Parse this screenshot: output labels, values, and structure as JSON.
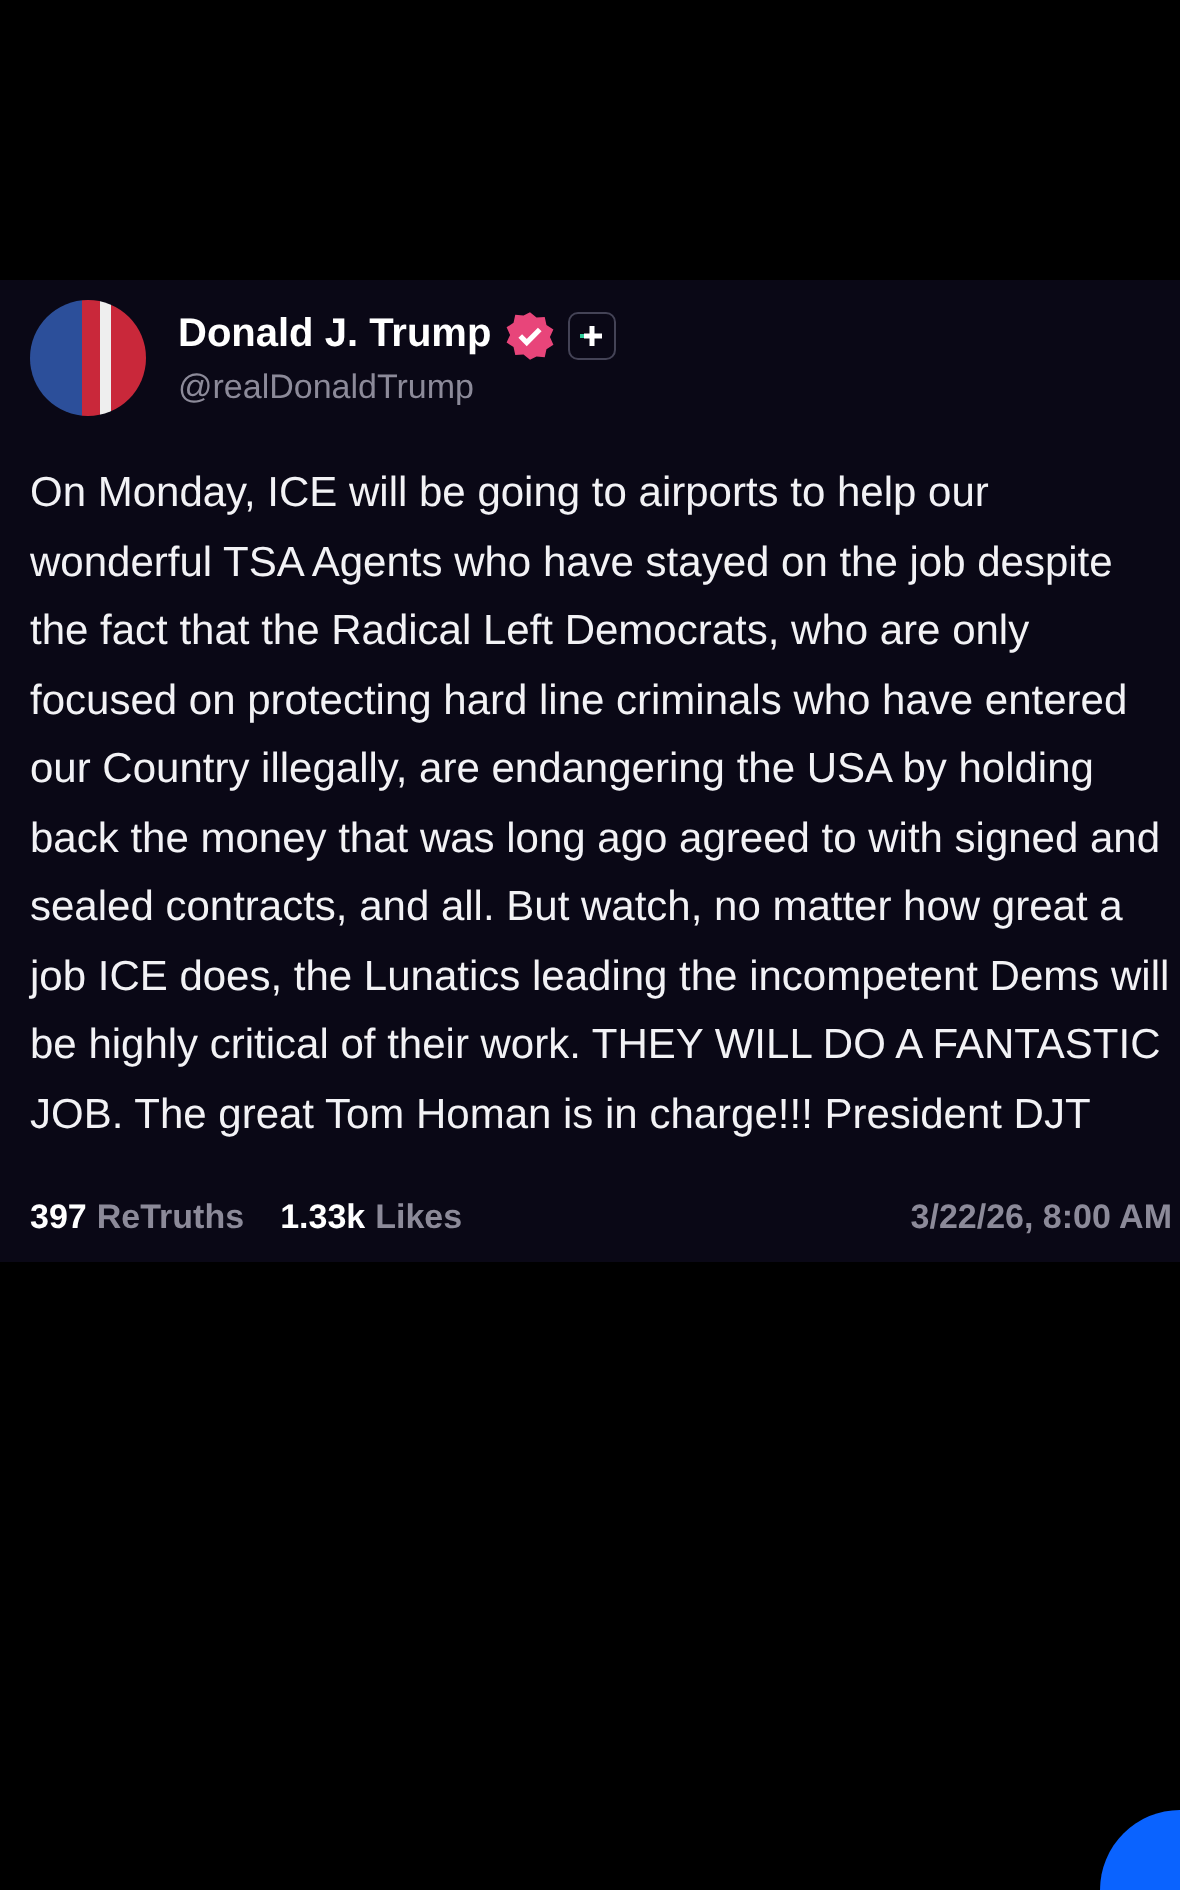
{
  "post": {
    "author": {
      "name": "Donald J. Trump",
      "handle": "@realDonaldTrump",
      "verified": true
    },
    "body": "On Monday, ICE will be going to airports to help our wonderful TSA Agents who have stayed on the job despite the fact that the Radical Left Democrats, who are only focused on protecting hard line criminals who have entered our Country illegally, are endangering the USA by holding back the money that was long ago agreed to with signed and sealed contracts, and all. But watch, no matter how great a job ICE does, the Lunatics leading the incompetent Dems will be highly critical of their work. THEY WILL DO A FANTASTIC JOB. The great Tom Homan is in charge!!! President DJT",
    "stats": [
      {
        "count": "397",
        "label": "ReTruths"
      },
      {
        "count": "1.33k",
        "label": "Likes"
      }
    ],
    "timestamp": "3/22/26, 8:00 AM"
  }
}
